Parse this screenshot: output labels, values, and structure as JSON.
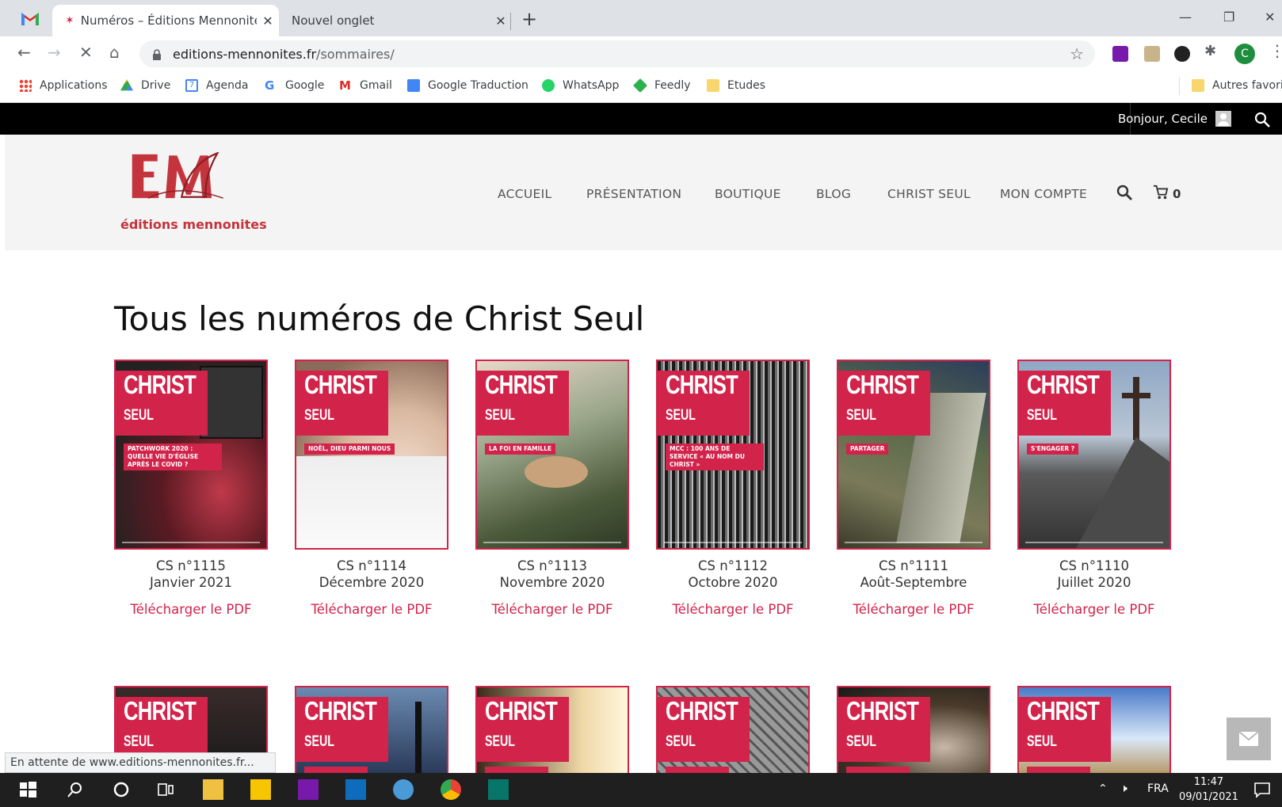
{
  "browser": {
    "tabs": [
      {
        "title": "Numéros – Éditions Mennonites",
        "active": true
      },
      {
        "title": "Nouvel onglet",
        "active": false
      }
    ],
    "address": {
      "host": "editions-mennonites.fr",
      "path": "/sommaires/"
    },
    "bookmarks": [
      "Applications",
      "Drive",
      "Agenda",
      "Google",
      "Gmail",
      "Google Traduction",
      "WhatsApp",
      "Feedly",
      "Etudes"
    ],
    "other_bookmarks": "Autres favoris",
    "profile_initial": "C"
  },
  "site": {
    "greeting": "Bonjour, Cecile",
    "logo_caption": "éditions mennonites",
    "nav": [
      "ACCUEIL",
      "PRÉSENTATION",
      "BOUTIQUE",
      "BLOG",
      "CHRIST SEUL",
      "MON COMPTE"
    ],
    "cart_count": "0",
    "page_title": "Tous les numéros de Christ Seul",
    "cover_brand": "CHRIST",
    "cover_sub": "SEUL",
    "issues": [
      {
        "number": "CS n°1115",
        "date": "Janvier 2021",
        "download": "Télécharger le PDF",
        "cover_tag": "PATCHWORK 2020 : QUELLE VIE D'ÉGLISE APRÈS LE COVID ?"
      },
      {
        "number": "CS n°1114",
        "date": "Décembre 2020",
        "download": "Télécharger le PDF",
        "cover_tag": "NOËL, DIEU PARMI NOUS"
      },
      {
        "number": "CS n°1113",
        "date": "Novembre 2020",
        "download": "Télécharger le PDF",
        "cover_tag": "LA FOI EN FAMILLE"
      },
      {
        "number": "CS n°1112",
        "date": "Octobre 2020",
        "download": "Télécharger le PDF",
        "cover_tag": "MCC : 100 ANS DE SERVICE « AU NOM DU CHRIST »"
      },
      {
        "number": "CS n°1111",
        "date": "Août-Septembre",
        "download": "Télécharger le PDF",
        "cover_tag": "PARTAGER"
      },
      {
        "number": "CS n°1110",
        "date": "Juillet 2020",
        "download": "Télécharger le PDF",
        "cover_tag": "S'ENGAGER ?"
      }
    ],
    "second_row_count": 6
  },
  "status_text": "En attente de www.editions-mennonites.fr...",
  "taskbar": {
    "language": "FRA",
    "time": "11:47",
    "date": "09/01/2021"
  },
  "colors": {
    "brand_red": "#d2234a",
    "topbar": "#000000",
    "header_bg": "#f4f4f4"
  }
}
